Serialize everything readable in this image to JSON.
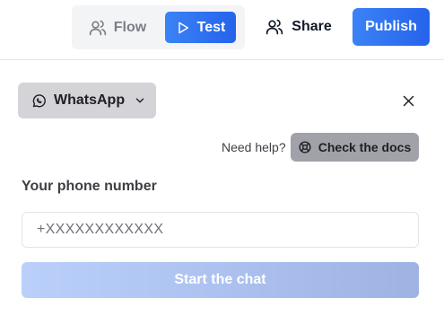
{
  "header": {
    "tabs": [
      {
        "label": "Flow",
        "icon": "users-icon",
        "active": false
      },
      {
        "label": "Test",
        "icon": "play-icon",
        "active": true
      }
    ],
    "share_label": "Share",
    "publish_label": "Publish"
  },
  "panel": {
    "channel": {
      "label": "WhatsApp",
      "icon": "whatsapp-icon"
    },
    "help_text": "Need help?",
    "docs_label": "Check the docs",
    "phone_label": "Your phone number",
    "phone_placeholder": "+XXXXXXXXXXXX",
    "phone_value": "",
    "start_label": "Start the chat"
  },
  "colors": {
    "accent": "#2563eb",
    "start_disabled": "#b3c7f3",
    "docs_button": "#a1a1aa",
    "channel_button": "#d4d4d8"
  }
}
